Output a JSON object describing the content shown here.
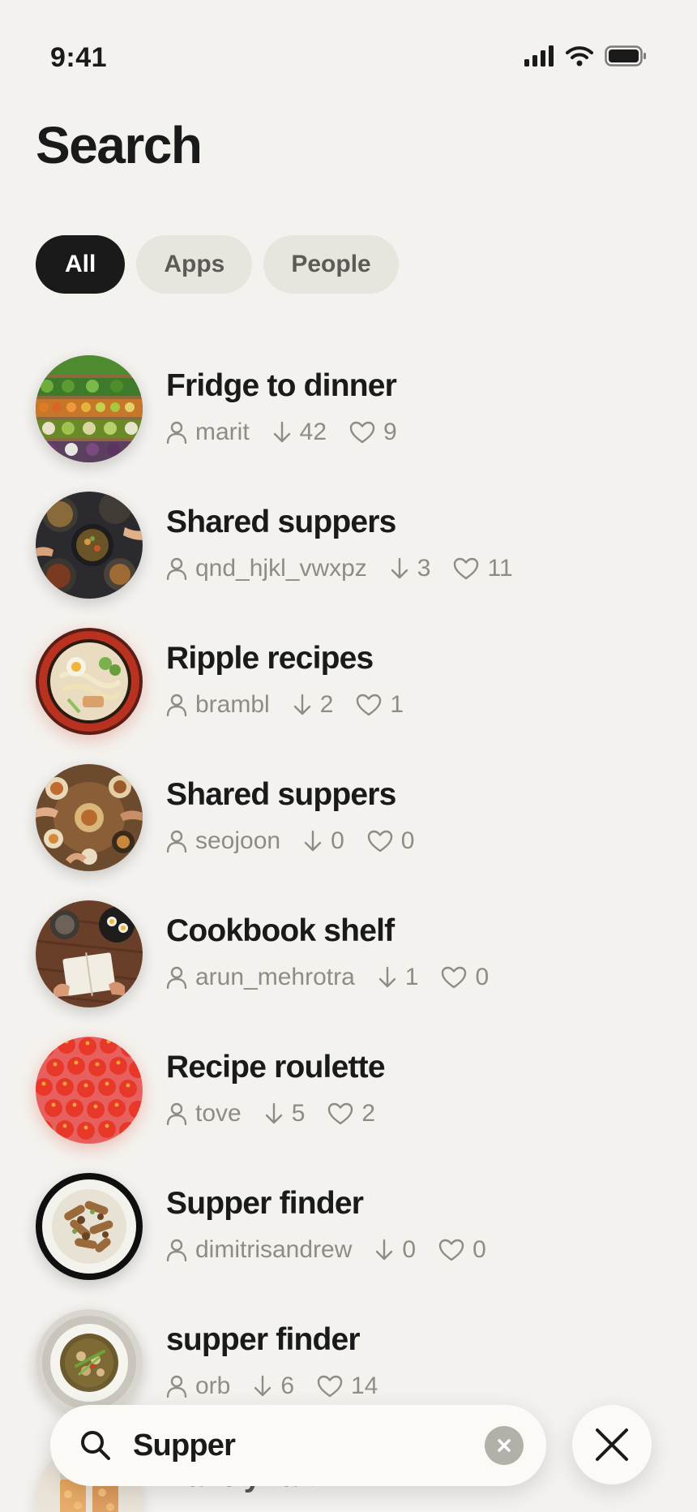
{
  "status_bar": {
    "time": "9:41"
  },
  "page": {
    "title": "Search"
  },
  "filters": [
    {
      "label": "All",
      "active": true
    },
    {
      "label": "Apps",
      "active": false
    },
    {
      "label": "People",
      "active": false
    }
  ],
  "results": [
    {
      "title": "Fridge to dinner",
      "author": "marit",
      "downloads": "42",
      "likes": "9",
      "thumbnail": "vegetable-market-shelves"
    },
    {
      "title": "Shared suppers",
      "author": "qnd_hjkl_vwxpz",
      "downloads": "3",
      "likes": "11",
      "thumbnail": "dishes-on-dark-table"
    },
    {
      "title": "Ripple recipes",
      "author": "brambl",
      "downloads": "2",
      "likes": "1",
      "thumbnail": "ramen-bowl"
    },
    {
      "title": "Shared suppers",
      "author": "seojoon",
      "downloads": "0",
      "likes": "0",
      "thumbnail": "shared-table-meal"
    },
    {
      "title": "Cookbook shelf",
      "author": "arun_mehrotra",
      "downloads": "1",
      "likes": "0",
      "thumbnail": "open-book-with-tea"
    },
    {
      "title": "Recipe roulette",
      "author": "tove",
      "downloads": "5",
      "likes": "2",
      "thumbnail": "tomatoes"
    },
    {
      "title": "Supper finder",
      "author": "dimitrisandrew",
      "downloads": "0",
      "likes": "0",
      "thumbnail": "pasta-plate"
    },
    {
      "title": "supper finder",
      "author": "orb",
      "downloads": "6",
      "likes": "14",
      "thumbnail": "stew-bowl"
    },
    {
      "title": "Pantry raid",
      "author": "",
      "downloads": "",
      "likes": "",
      "thumbnail": "jars-of-preserves"
    }
  ],
  "search": {
    "value": "Supper"
  },
  "colors": {
    "background": "#f4f2ee",
    "active_chip": "#1a1a1a",
    "inactive_chip": "#e8e5df",
    "meta_text": "#8f8b85"
  }
}
